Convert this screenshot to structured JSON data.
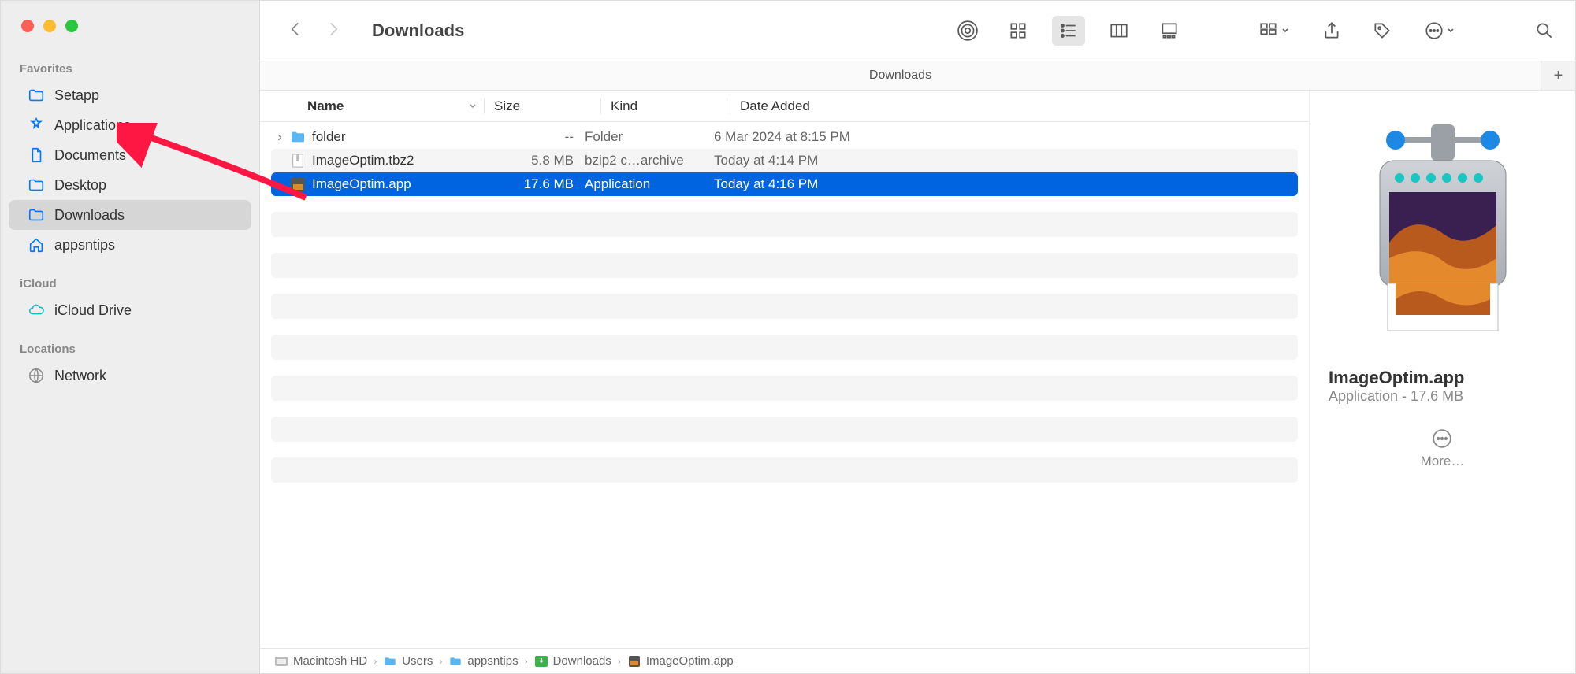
{
  "window": {
    "title": "Downloads",
    "tab": "Downloads"
  },
  "sidebar": {
    "sections": [
      {
        "label": "Favorites",
        "items": [
          {
            "label": "Setapp",
            "icon": "folder",
            "active": false
          },
          {
            "label": "Applications",
            "icon": "apps",
            "active": false
          },
          {
            "label": "Documents",
            "icon": "document",
            "active": false
          },
          {
            "label": "Desktop",
            "icon": "folder",
            "active": false
          },
          {
            "label": "Downloads",
            "icon": "folder",
            "active": true
          },
          {
            "label": "appsntips",
            "icon": "home",
            "active": false
          }
        ]
      },
      {
        "label": "iCloud",
        "items": [
          {
            "label": "iCloud Drive",
            "icon": "cloud",
            "active": false
          }
        ]
      },
      {
        "label": "Locations",
        "items": [
          {
            "label": "Network",
            "icon": "globe",
            "active": false
          }
        ]
      }
    ]
  },
  "columns": {
    "name": "Name",
    "size": "Size",
    "kind": "Kind",
    "date": "Date Added"
  },
  "files": [
    {
      "name": "folder",
      "size": "--",
      "kind": "Folder",
      "date": "6 Mar 2024 at 8:15 PM",
      "icon": "folder",
      "expandable": true,
      "sel": false
    },
    {
      "name": "ImageOptim.tbz2",
      "size": "5.8 MB",
      "kind": "bzip2 c…archive",
      "date": "Today at 4:14 PM",
      "icon": "archive",
      "expandable": false,
      "sel": false
    },
    {
      "name": "ImageOptim.app",
      "size": "17.6 MB",
      "kind": "Application",
      "date": "Today at 4:16 PM",
      "icon": "app",
      "expandable": false,
      "sel": true
    }
  ],
  "preview": {
    "name": "ImageOptim.app",
    "subtitle": "Application - 17.6 MB",
    "more": "More…"
  },
  "pathbar": [
    {
      "label": "Macintosh HD",
      "icon": "disk"
    },
    {
      "label": "Users",
      "icon": "folder-blue"
    },
    {
      "label": "appsntips",
      "icon": "folder-blue"
    },
    {
      "label": "Downloads",
      "icon": "folder-green"
    },
    {
      "label": "ImageOptim.app",
      "icon": "app"
    }
  ]
}
